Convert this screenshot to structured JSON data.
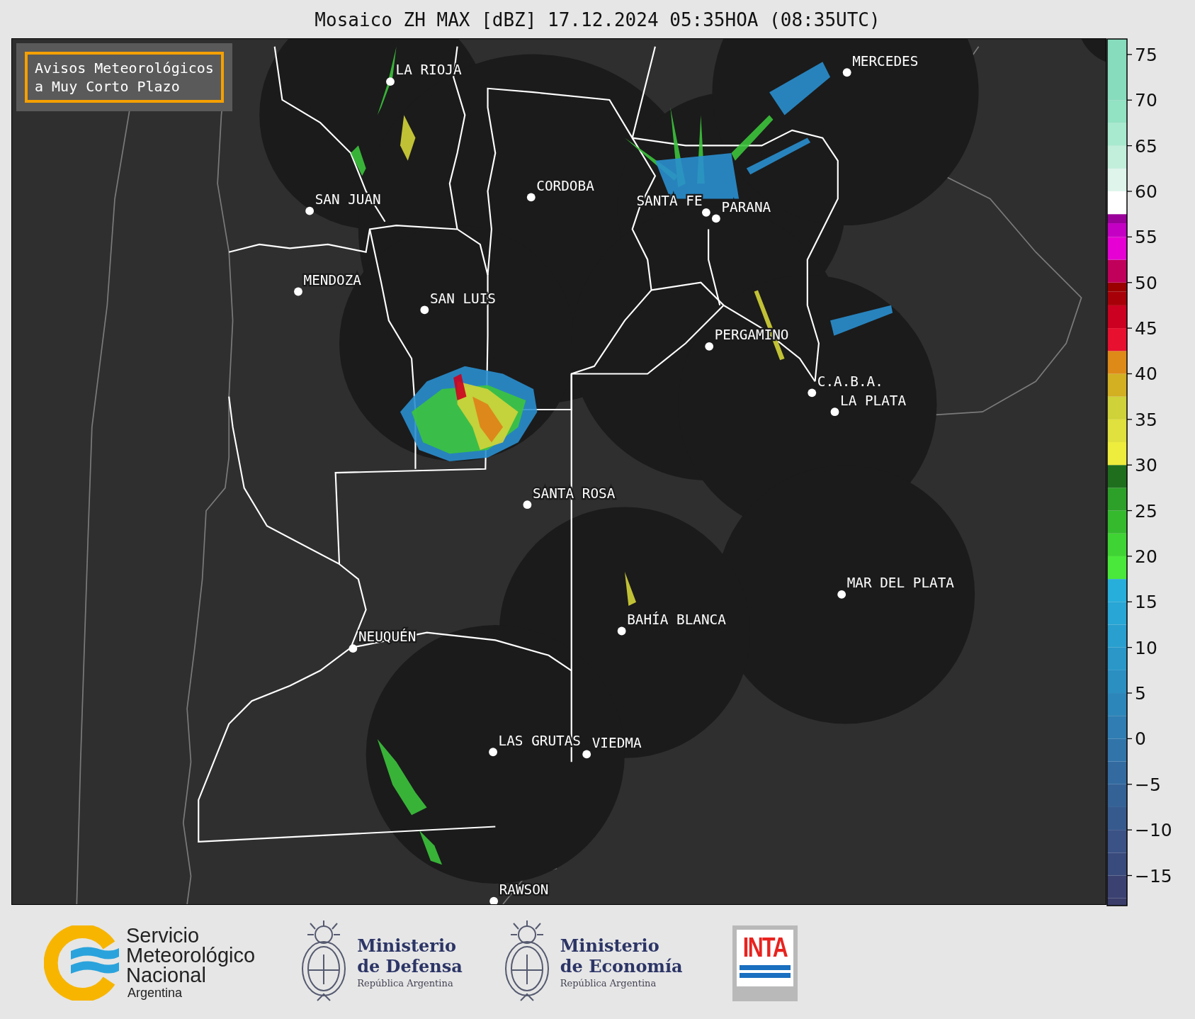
{
  "title": "Mosaico ZH MAX [dBZ] 17.12.2024 05:35HOA (08:35UTC)",
  "notice": {
    "lines": [
      "Avisos Meteorológicos",
      "a Muy Corto Plazo"
    ]
  },
  "cities": [
    {
      "name": "LA RIOJA"
    },
    {
      "name": "SAN JUAN"
    },
    {
      "name": "CORDOBA"
    },
    {
      "name": "SANTA FE"
    },
    {
      "name": "PARANA"
    },
    {
      "name": "MERCEDES"
    },
    {
      "name": "MENDOZA"
    },
    {
      "name": "SAN LUIS"
    },
    {
      "name": "PERGAMINO"
    },
    {
      "name": "C.A.B.A."
    },
    {
      "name": "LA PLATA"
    },
    {
      "name": "SANTA ROSA"
    },
    {
      "name": "MAR DEL PLATA"
    },
    {
      "name": "BAHÍA BLANCA"
    },
    {
      "name": "NEUQUÉN"
    },
    {
      "name": "LAS GRUTAS"
    },
    {
      "name": "VIEDMA"
    },
    {
      "name": "RAWSON"
    }
  ],
  "colorbar": {
    "ticks": [
      "75",
      "70",
      "65",
      "60",
      "55",
      "50",
      "45",
      "40",
      "35",
      "30",
      "25",
      "20",
      "15",
      "10",
      "5",
      "0",
      "−5",
      "−10",
      "−15"
    ]
  },
  "logos": [
    {
      "kind": "smn",
      "lines": [
        "Servicio",
        "Meteorológico",
        "Nacional"
      ],
      "subtitle": "Argentina"
    },
    {
      "kind": "ministry",
      "lines": [
        "Ministerio",
        "de Defensa"
      ],
      "subtitle": "República Argentina"
    },
    {
      "kind": "ministry",
      "lines": [
        "Ministerio",
        "de Economía"
      ],
      "subtitle": "República Argentina"
    },
    {
      "kind": "inta",
      "text": "INTA"
    }
  ]
}
